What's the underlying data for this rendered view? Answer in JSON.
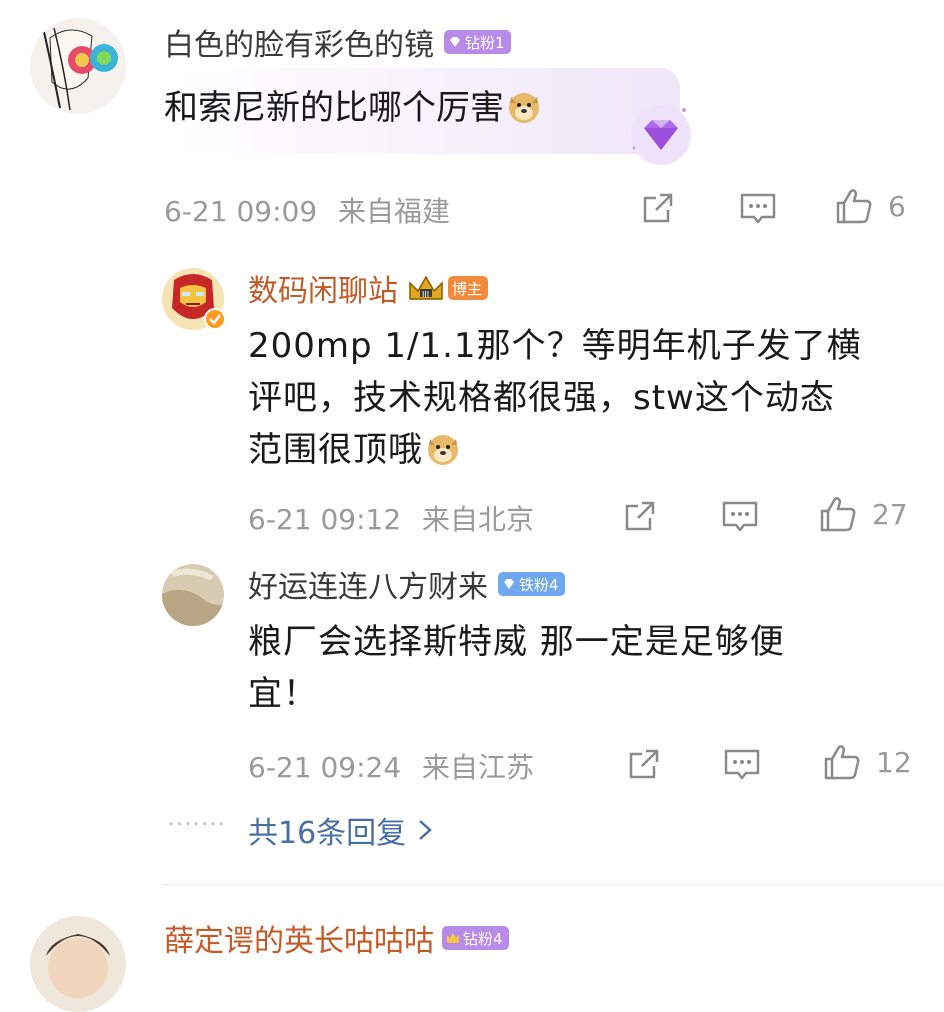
{
  "comments": [
    {
      "user": "白色的脸有彩色的镜",
      "badge": "钻粉1",
      "text": "和索尼新的比哪个厉害",
      "time": "6-21 09:09",
      "location": "来自福建",
      "likes": "6"
    },
    {
      "user": "数码闲聊站",
      "badge": "博主",
      "text_lines": [
        "200mp 1/1.1那个？等明年机子发了横",
        "评吧，技术规格都很强，stw这个动态",
        "范围很顶哦"
      ],
      "time": "6-21 09:12",
      "location": "来自北京",
      "likes": "27"
    },
    {
      "user": "好运连连八方财来",
      "badge": "铁粉4",
      "text_lines": [
        "粮厂会选择斯特威 那一定是足够便",
        "宜！"
      ],
      "time": "6-21 09:24",
      "location": "来自江苏",
      "likes": "12"
    }
  ],
  "replies_link": "共16条回复",
  "next_user": {
    "user": "薛定谔的英长咕咕咕",
    "badge": "钻粉4"
  },
  "colors": {
    "accent": "#c35a28",
    "link": "#4a6fa5",
    "meta": "#9a9a9a"
  }
}
